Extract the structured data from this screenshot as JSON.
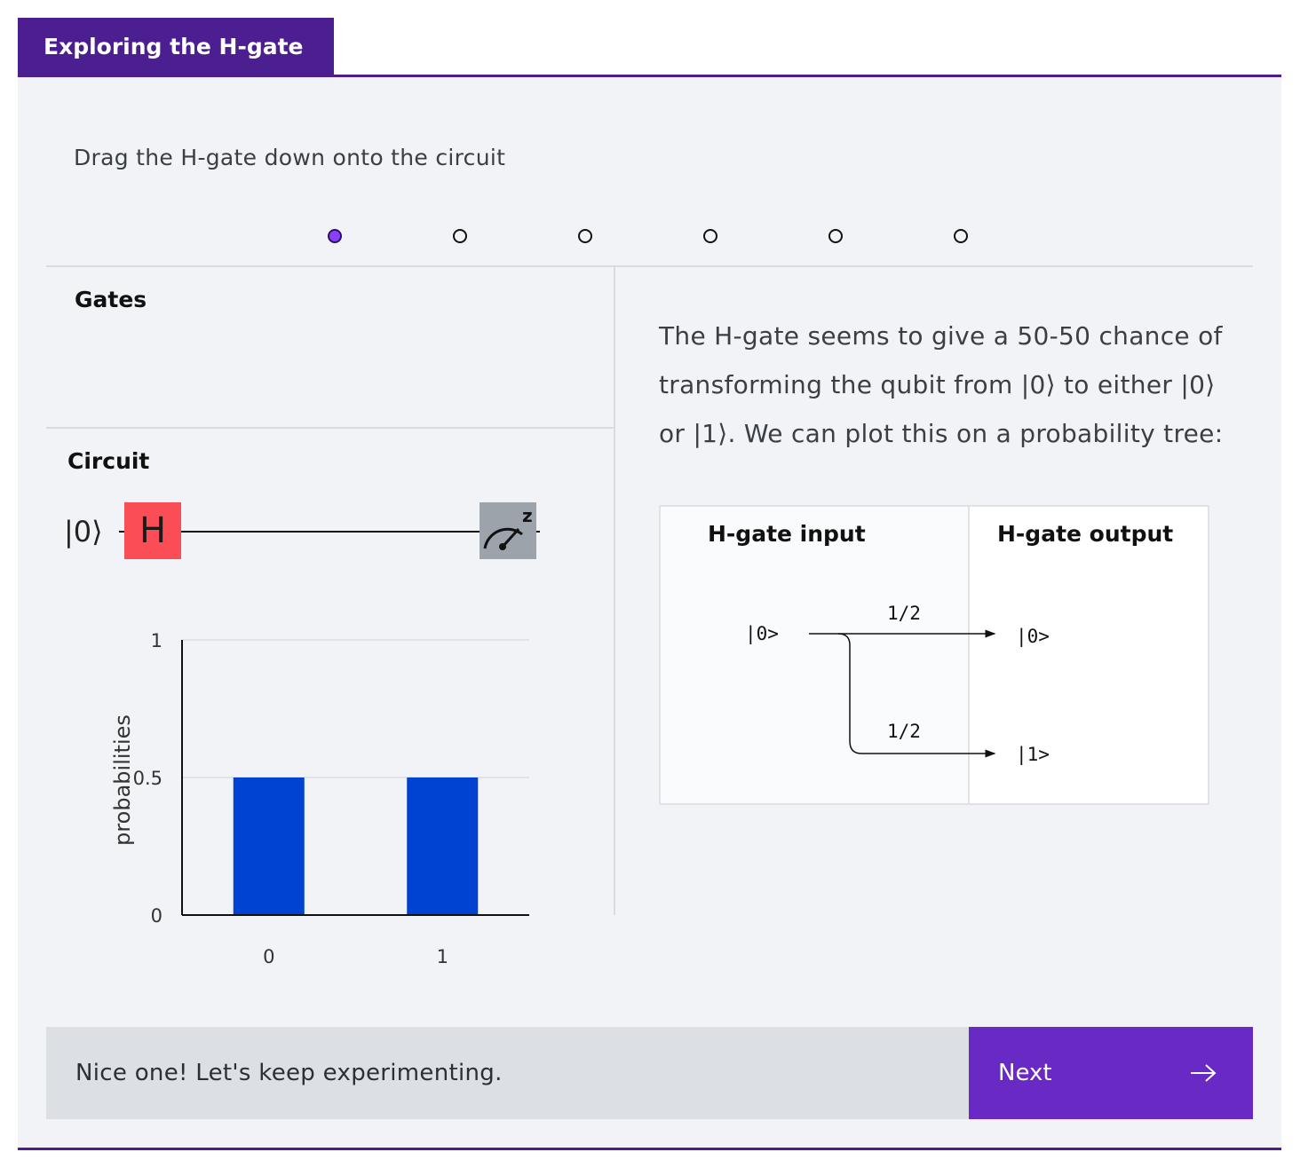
{
  "tab": {
    "title": "Exploring the H-gate"
  },
  "instruction": "Drag the H-gate down onto the circuit",
  "steps": {
    "total": 6,
    "current": 1
  },
  "gates_panel": {
    "title": "Gates"
  },
  "circuit_panel": {
    "title": "Circuit",
    "qubit_label": "|0⟩",
    "gate_label": "H",
    "measure_label": "z"
  },
  "chart_data": {
    "type": "bar",
    "categories": [
      "0",
      "1"
    ],
    "values": [
      0.5,
      0.5
    ],
    "ylabel": "probabilities",
    "yticks": [
      "0",
      "0.5",
      "1"
    ],
    "ylim": [
      0,
      1
    ],
    "bar_color": "#0042d1",
    "grid": true
  },
  "explanation": "The H-gate seems to give a 50-50 chance of transforming the qubit from |0⟩ to either |0⟩ or |1⟩. We can plot this on a probability tree:",
  "tree": {
    "input_header": "H-gate input",
    "output_header": "H-gate output",
    "input_state": "|0>",
    "branches": [
      {
        "probability": "1/2",
        "output_state": "|0>"
      },
      {
        "probability": "1/2",
        "output_state": "|1>"
      }
    ]
  },
  "feedback": "Nice one! Let's keep experimenting.",
  "next_button": {
    "label": "Next",
    "icon": "arrow-right-icon"
  },
  "colors": {
    "accent": "#4b1f8f",
    "button": "#6929c4",
    "gate": "#fa4d56",
    "active_dot": "#8a3ffc"
  }
}
